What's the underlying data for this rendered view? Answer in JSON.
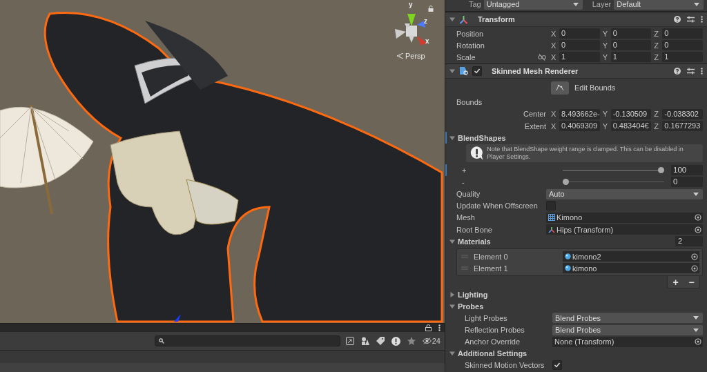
{
  "scene": {
    "gizmo_axes": [
      "y",
      "z",
      "x"
    ],
    "projection": "Persp"
  },
  "bottom_panel": {
    "hidden_count": "24"
  },
  "inspector": {
    "tag": {
      "label": "Tag",
      "value": "Untagged"
    },
    "layer": {
      "label": "Layer",
      "value": "Default"
    },
    "transform": {
      "title": "Transform",
      "expanded": true,
      "rows": [
        {
          "label": "Position",
          "fields": [
            {
              "axis": "X",
              "value": "0"
            },
            {
              "axis": "Y",
              "value": "0"
            },
            {
              "axis": "Z",
              "value": "0"
            }
          ]
        },
        {
          "label": "Rotation",
          "fields": [
            {
              "axis": "X",
              "value": "0"
            },
            {
              "axis": "Y",
              "value": "0"
            },
            {
              "axis": "Z",
              "value": "0"
            }
          ]
        },
        {
          "label": "Scale",
          "constrained": false,
          "fields": [
            {
              "axis": "X",
              "value": "1"
            },
            {
              "axis": "Y",
              "value": "1"
            },
            {
              "axis": "Z",
              "value": "1"
            }
          ]
        }
      ]
    },
    "renderer": {
      "title": "Skinned Mesh Renderer",
      "expanded": true,
      "enabled": true,
      "edit_bounds": "Edit Bounds",
      "bounds_label": "Bounds",
      "bounds": [
        {
          "label": "Center",
          "fields": [
            {
              "axis": "X",
              "value": "8.493662e-"
            },
            {
              "axis": "Y",
              "value": "-0.130509"
            },
            {
              "axis": "Z",
              "value": "-0.038302"
            }
          ]
        },
        {
          "label": "Extent",
          "fields": [
            {
              "axis": "X",
              "value": "0.4069309"
            },
            {
              "axis": "Y",
              "value": "0.483404€"
            },
            {
              "axis": "Z",
              "value": "0.1677293"
            }
          ]
        }
      ],
      "blendshapes": {
        "title": "BlendShapes",
        "expanded": true,
        "note": "Note that BlendShape weight range is clamped. This can be disabled in Player Settings.",
        "sliders": [
          {
            "label": "+",
            "level": 1,
            "value": "100"
          },
          {
            "label": "-",
            "level": 0,
            "value": "0"
          }
        ]
      },
      "properties": [
        {
          "kind": "dropdown",
          "label": "Quality",
          "value": "Auto"
        },
        {
          "kind": "checkbox",
          "label": "Update When Offscreen",
          "checked": false
        },
        {
          "kind": "mesh",
          "label": "Mesh",
          "value": "Kimono"
        },
        {
          "kind": "bone",
          "label": "Root Bone",
          "value": "Hips (Transform)"
        }
      ],
      "materials": {
        "title": "Materials",
        "count": "2",
        "expanded": true,
        "elements": [
          {
            "label": "Element 0",
            "value": "kimono2"
          },
          {
            "label": "Element 1",
            "value": "kimono"
          }
        ],
        "add": "+",
        "remove": "−"
      },
      "sections": [
        {
          "title": "Lighting",
          "expanded": false
        },
        {
          "title": "Probes",
          "expanded": true,
          "rows": [
            {
              "kind": "dropdown",
              "label": "Light Probes",
              "value": "Blend Probes"
            },
            {
              "kind": "dropdown",
              "label": "Reflection Probes",
              "value": "Blend Probes"
            },
            {
              "kind": "object",
              "label": "Anchor Override",
              "value": "None (Transform)"
            }
          ]
        },
        {
          "title": "Additional Settings",
          "expanded": true,
          "rows": [
            {
              "kind": "checkbox",
              "label": "Skinned Motion Vectors",
              "checked": true
            }
          ]
        }
      ]
    }
  }
}
